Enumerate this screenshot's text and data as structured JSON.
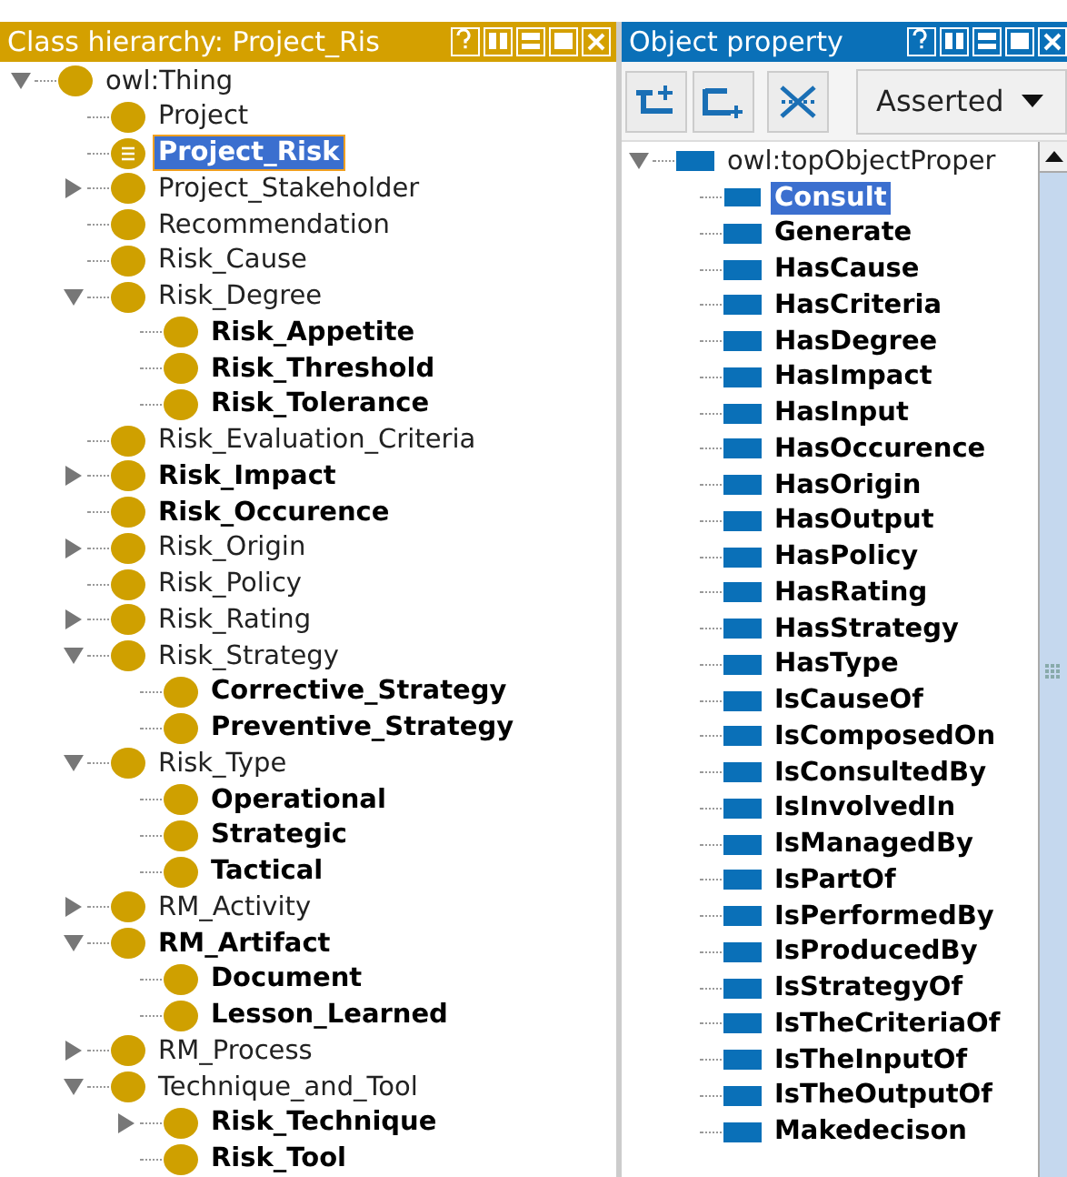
{
  "class_panel": {
    "title": "Class hierarchy: Project_Ris",
    "tree": [
      {
        "label": "owl:Thing",
        "kind": "class",
        "bold": false,
        "selected": false,
        "expanded": true,
        "children": [
          {
            "label": "Project",
            "kind": "class",
            "bold": false,
            "selected": false
          },
          {
            "label": "Project_Risk",
            "kind": "defined",
            "bold": true,
            "selected": true
          },
          {
            "label": "Project_Stakeholder",
            "kind": "class",
            "bold": false,
            "selected": false,
            "expanded": false
          },
          {
            "label": "Recommendation",
            "kind": "class",
            "bold": false,
            "selected": false
          },
          {
            "label": "Risk_Cause",
            "kind": "class",
            "bold": false,
            "selected": false
          },
          {
            "label": "Risk_Degree",
            "kind": "class",
            "bold": false,
            "selected": false,
            "expanded": true,
            "children": [
              {
                "label": "Risk_Appetite",
                "kind": "class",
                "bold": true,
                "selected": false
              },
              {
                "label": "Risk_Threshold",
                "kind": "class",
                "bold": true,
                "selected": false
              },
              {
                "label": "Risk_Tolerance",
                "kind": "class",
                "bold": true,
                "selected": false
              }
            ]
          },
          {
            "label": "Risk_Evaluation_Criteria",
            "kind": "class",
            "bold": false,
            "selected": false
          },
          {
            "label": "Risk_Impact",
            "kind": "class",
            "bold": true,
            "selected": false,
            "expanded": false
          },
          {
            "label": "Risk_Occurence",
            "kind": "class",
            "bold": true,
            "selected": false
          },
          {
            "label": "Risk_Origin",
            "kind": "class",
            "bold": false,
            "selected": false,
            "expanded": false
          },
          {
            "label": "Risk_Policy",
            "kind": "class",
            "bold": false,
            "selected": false
          },
          {
            "label": "Risk_Rating",
            "kind": "class",
            "bold": false,
            "selected": false,
            "expanded": false
          },
          {
            "label": "Risk_Strategy",
            "kind": "class",
            "bold": false,
            "selected": false,
            "expanded": true,
            "children": [
              {
                "label": "Corrective_Strategy",
                "kind": "class",
                "bold": true,
                "selected": false
              },
              {
                "label": "Preventive_Strategy",
                "kind": "class",
                "bold": true,
                "selected": false
              }
            ]
          },
          {
            "label": "Risk_Type",
            "kind": "class",
            "bold": false,
            "selected": false,
            "expanded": true,
            "children": [
              {
                "label": "Operational",
                "kind": "class",
                "bold": true,
                "selected": false
              },
              {
                "label": "Strategic",
                "kind": "class",
                "bold": true,
                "selected": false
              },
              {
                "label": "Tactical",
                "kind": "class",
                "bold": true,
                "selected": false
              }
            ]
          },
          {
            "label": "RM_Activity",
            "kind": "class",
            "bold": false,
            "selected": false,
            "expanded": false
          },
          {
            "label": "RM_Artifact",
            "kind": "class",
            "bold": true,
            "selected": false,
            "expanded": true,
            "children": [
              {
                "label": "Document",
                "kind": "class",
                "bold": true,
                "selected": false
              },
              {
                "label": "Lesson_Learned",
                "kind": "class",
                "bold": true,
                "selected": false
              }
            ]
          },
          {
            "label": "RM_Process",
            "kind": "class",
            "bold": false,
            "selected": false,
            "expanded": false
          },
          {
            "label": "Technique_and_Tool",
            "kind": "class",
            "bold": false,
            "selected": false,
            "expanded": true,
            "children": [
              {
                "label": "Risk_Technique",
                "kind": "class",
                "bold": true,
                "selected": false,
                "expanded": false
              },
              {
                "label": "Risk_Tool",
                "kind": "class",
                "bold": true,
                "selected": false
              }
            ]
          }
        ]
      }
    ]
  },
  "property_panel": {
    "title": "Object property",
    "view_dropdown": {
      "value": "Asserted"
    },
    "tree": [
      {
        "label": "owl:topObjectProper",
        "bold": false,
        "selected": false,
        "expanded": true,
        "children": [
          {
            "label": "Consult",
            "bold": true,
            "selected": true
          },
          {
            "label": "Generate",
            "bold": true,
            "selected": false
          },
          {
            "label": "HasCause",
            "bold": true,
            "selected": false
          },
          {
            "label": "HasCriteria",
            "bold": true,
            "selected": false
          },
          {
            "label": "HasDegree",
            "bold": true,
            "selected": false
          },
          {
            "label": "HasImpact",
            "bold": true,
            "selected": false
          },
          {
            "label": "HasInput",
            "bold": true,
            "selected": false
          },
          {
            "label": "HasOccurence",
            "bold": true,
            "selected": false
          },
          {
            "label": "HasOrigin",
            "bold": true,
            "selected": false
          },
          {
            "label": "HasOutput",
            "bold": true,
            "selected": false
          },
          {
            "label": "HasPolicy",
            "bold": true,
            "selected": false
          },
          {
            "label": "HasRating",
            "bold": true,
            "selected": false
          },
          {
            "label": "HasStrategy",
            "bold": true,
            "selected": false
          },
          {
            "label": "HasType",
            "bold": true,
            "selected": false
          },
          {
            "label": "IsCauseOf",
            "bold": true,
            "selected": false
          },
          {
            "label": "IsComposedOn",
            "bold": true,
            "selected": false
          },
          {
            "label": "IsConsultedBy",
            "bold": true,
            "selected": false
          },
          {
            "label": "IsInvolvedIn",
            "bold": true,
            "selected": false
          },
          {
            "label": "IsManagedBy",
            "bold": true,
            "selected": false
          },
          {
            "label": "IsPartOf",
            "bold": true,
            "selected": false
          },
          {
            "label": "IsPerformedBy",
            "bold": true,
            "selected": false
          },
          {
            "label": "IsProducedBy",
            "bold": true,
            "selected": false
          },
          {
            "label": "IsStrategyOf",
            "bold": true,
            "selected": false
          },
          {
            "label": "IsTheCriteriaOf",
            "bold": true,
            "selected": false
          },
          {
            "label": "IsTheInputOf",
            "bold": true,
            "selected": false
          },
          {
            "label": "IsTheOutputOf",
            "bold": true,
            "selected": false
          },
          {
            "label": "Makedecison",
            "bold": true,
            "selected": false
          }
        ]
      }
    ]
  }
}
